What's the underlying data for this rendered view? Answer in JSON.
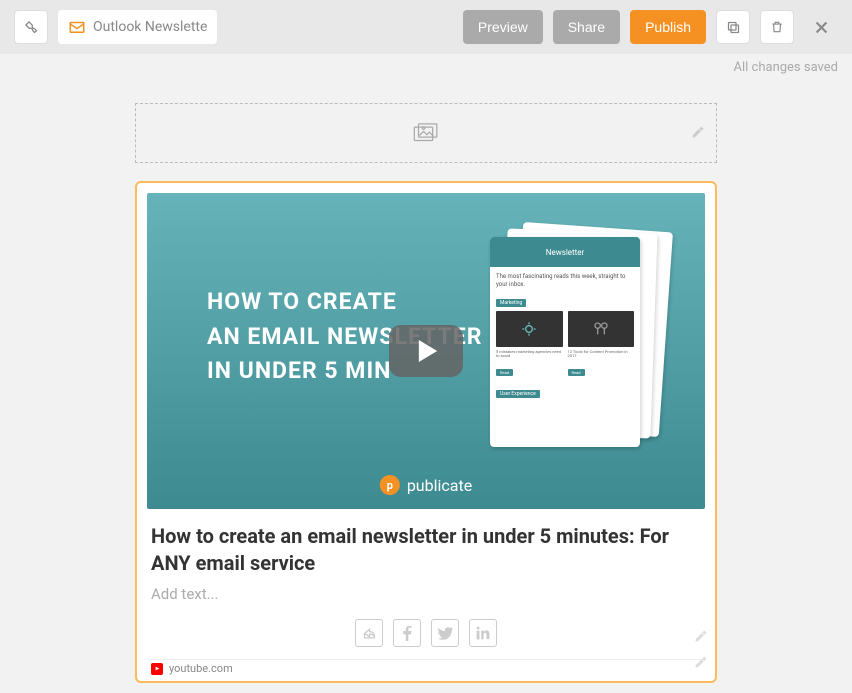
{
  "toolbar": {
    "title": "Outlook Newslette",
    "preview_label": "Preview",
    "share_label": "Share",
    "publish_label": "Publish"
  },
  "status": "All changes saved",
  "video": {
    "line1": "HOW TO CREATE",
    "line2": "AN EMAIL NEWSLETTER",
    "line3": "IN UNDER 5 MIN",
    "brand": "publicate",
    "mock_header": "Newsletter",
    "mock_sub": "The most fascinating reads this week, straight to your inbox.",
    "mock_tag1": "Marketing",
    "mock_tag2": "User Experience",
    "mock_col1_title": "5 mistakes marketing agencies need to avoid",
    "mock_col2_title": "12 Tools for Content Promotion in 2017"
  },
  "card": {
    "title": "How to create an email newsletter in under 5 minutes: For ANY email service",
    "placeholder": "Add text...",
    "source": "youtube.com"
  }
}
